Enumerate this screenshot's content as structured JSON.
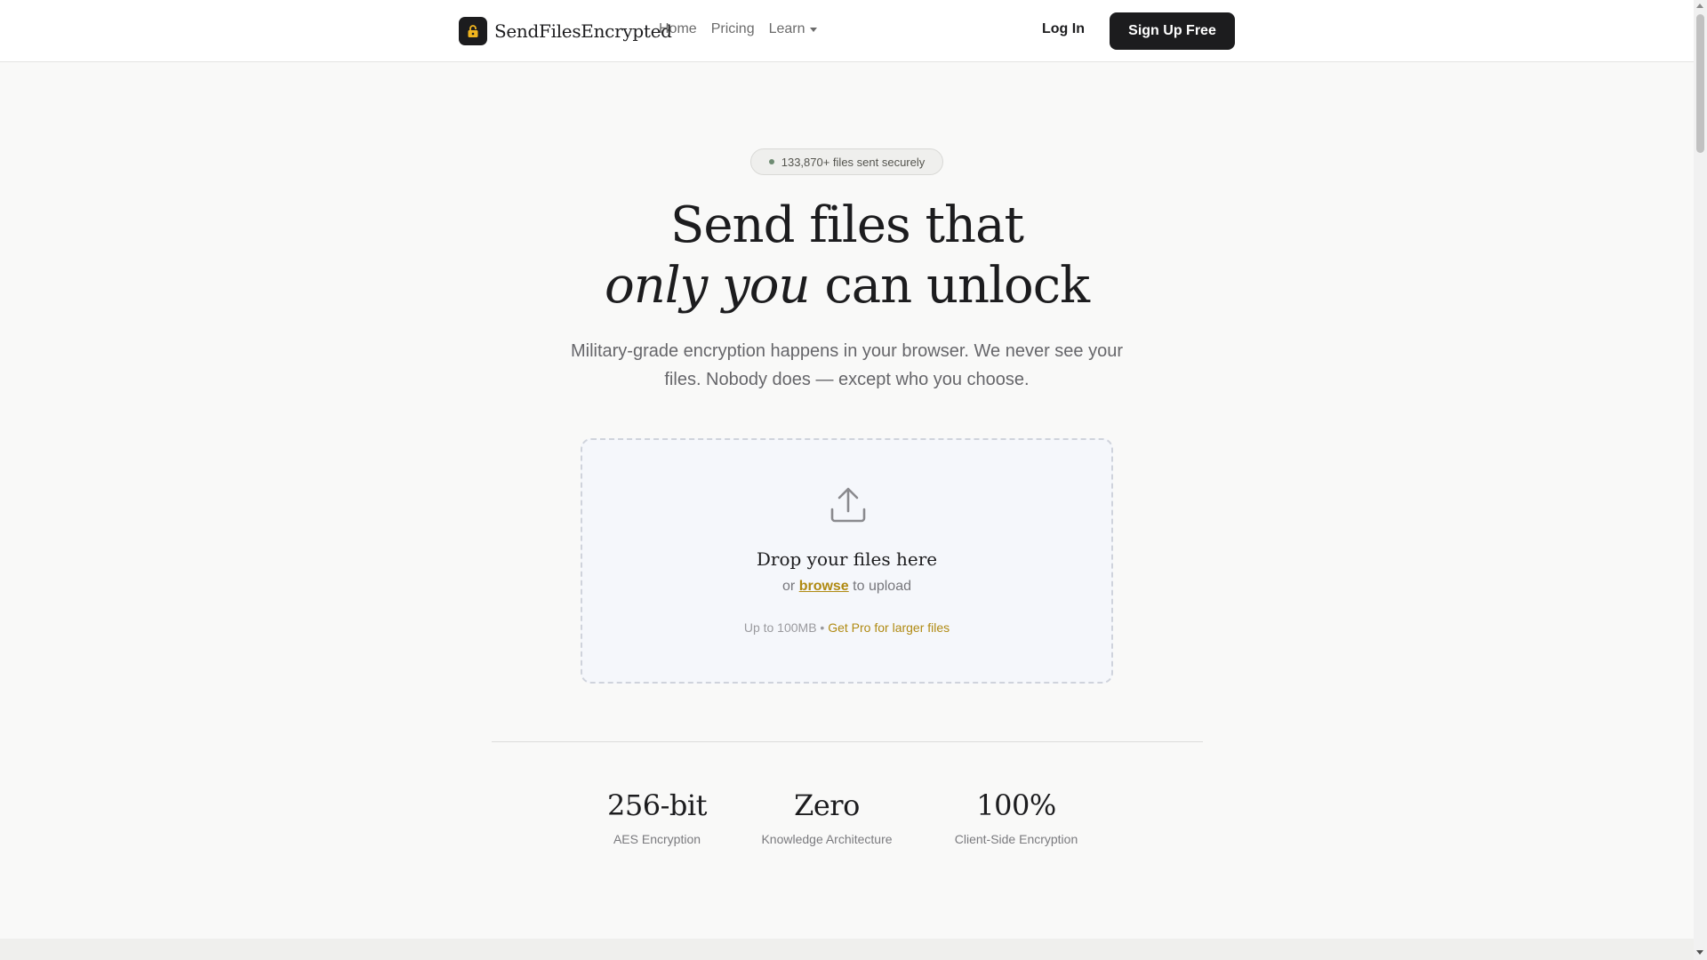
{
  "nav": {
    "brand": "SendFilesEncrypted",
    "brand_icon": "lock-icon",
    "links": [
      "Home",
      "Pricing",
      "Learn"
    ],
    "login": "Log In",
    "signup": "Sign Up Free"
  },
  "hero": {
    "badge": "133,870+ files sent securely",
    "headline_line1": "Send files that",
    "headline_italic": "only you",
    "headline_rest": " can unlock",
    "subtext": "Military-grade encryption happens in your browser. We never see your files. Nobody does — except who you choose."
  },
  "dropzone": {
    "icon": "upload-icon",
    "title": "Drop your files here",
    "or": "or ",
    "browse": "browse",
    "to_upload": " to upload",
    "limit": "Up to 100MB • ",
    "pro_link": "Get Pro for larger files"
  },
  "stats": [
    {
      "value": "256-bit",
      "label": "AES Encryption"
    },
    {
      "value": "Zero",
      "label": "Knowledge Architecture"
    },
    {
      "value": "100%",
      "label": "Client-Side Encryption"
    }
  ],
  "colors": {
    "accent": "#b08a12",
    "dark": "#1c1c1e",
    "background": "#f9f9f8"
  }
}
